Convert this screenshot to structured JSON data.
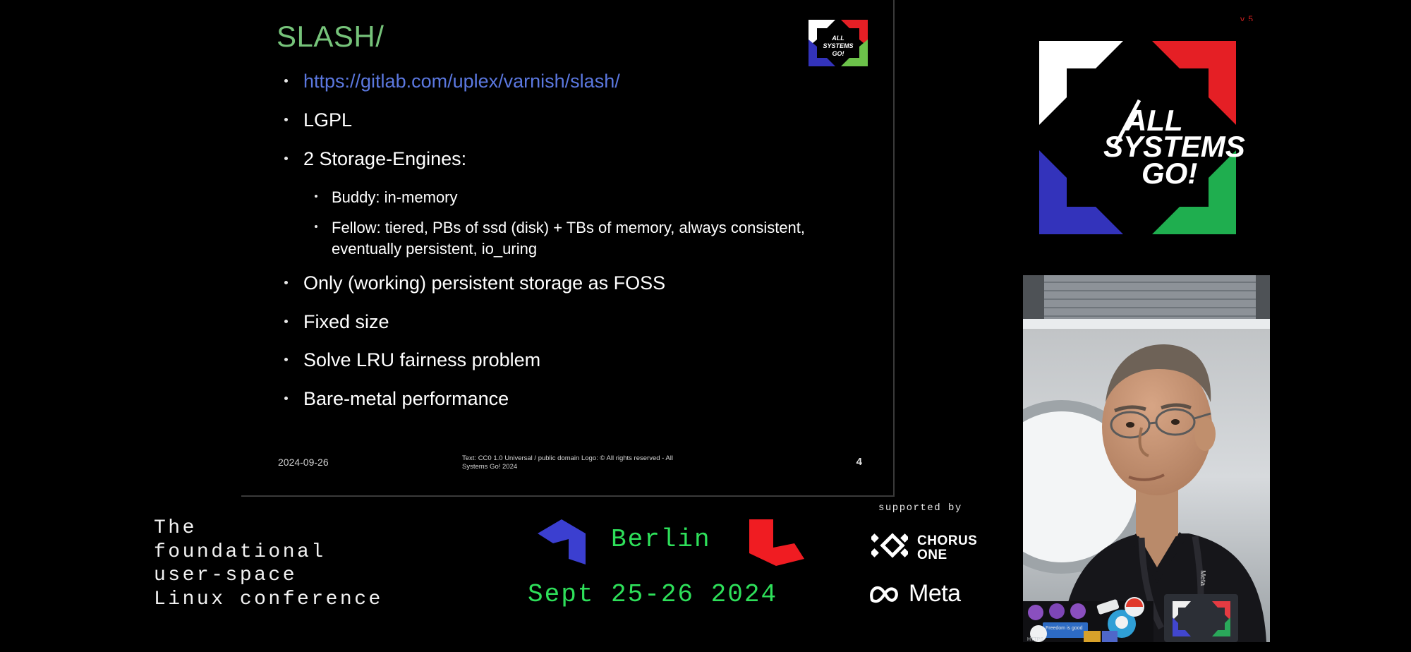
{
  "slide": {
    "title": "SLASH/",
    "bullets": [
      {
        "text": "https://gitlab.com/uplex/varnish/slash/",
        "kind": "link",
        "level": 1
      },
      {
        "text": "LGPL",
        "kind": "text",
        "level": 1
      },
      {
        "text": "2 Storage-Engines:",
        "kind": "text",
        "level": 1
      },
      {
        "text": "Buddy: in-memory",
        "kind": "text",
        "level": 2
      },
      {
        "text": "Fellow: tiered, PBs of ssd (disk) + TBs of memory, always consistent, eventually persistent, io_uring",
        "kind": "text",
        "level": 2
      },
      {
        "text": "Only (working) persistent storage as FOSS",
        "kind": "text",
        "level": 1
      },
      {
        "text": "Fixed size",
        "kind": "text",
        "level": 1
      },
      {
        "text": "Solve LRU fairness problem",
        "kind": "text",
        "level": 1
      },
      {
        "text": "Bare-metal performance",
        "kind": "text",
        "level": 1
      }
    ],
    "footer": {
      "date": "2024-09-26",
      "copyright": "Text: CC0 1.0 Universal  / public domain Logo: © All rights reserved - All Systems Go! 2024",
      "page_number": "4"
    },
    "logo_text_lines": [
      "ALL",
      "SYSTEMS",
      "GO!"
    ]
  },
  "big_logo": {
    "version_label": "v 5",
    "text_lines": [
      "ALL",
      "SYSTEMS",
      "GO!"
    ],
    "colors": {
      "top_left": "#ffffff",
      "top_right": "#e51f25",
      "bottom_left": "#3333bb",
      "bottom_right": "#1fae4f"
    }
  },
  "banner": {
    "tagline": "The\nfoundational\nuser-space\nLinux conference",
    "city": "Berlin",
    "dates": "Sept 25-26 2024",
    "supported_by_label": "supported by",
    "sponsors": [
      {
        "name": "CHORUS\nONE",
        "icon": "chorus-one-diamond-icon"
      },
      {
        "name": "Meta",
        "icon": "meta-infinity-icon"
      }
    ],
    "accent_green": "#2ee05a",
    "arrow_blue": "#3b3fd0",
    "arrow_red": "#f01c22"
  },
  "video_feed": {
    "description": "speaker-camera-feed"
  }
}
